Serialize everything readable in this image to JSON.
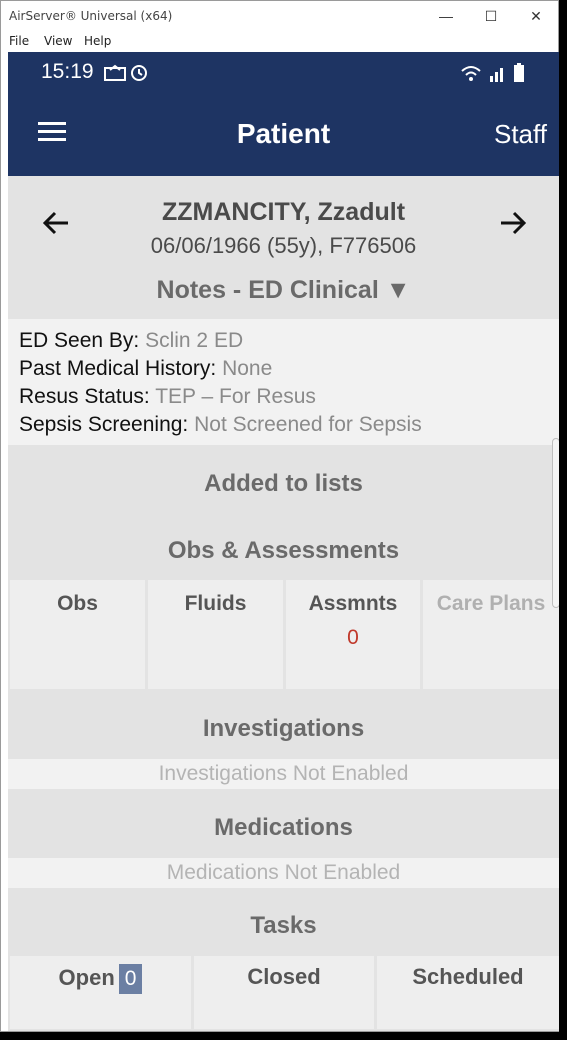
{
  "window": {
    "title": "AirServer® Universal (x64)",
    "minimize": "—",
    "maximize": "☐",
    "close": "✕"
  },
  "menu": [
    "File",
    "View",
    "Help"
  ],
  "status_bar": {
    "time": "15:19"
  },
  "app_bar": {
    "title": "Patient",
    "right_label": "Staff"
  },
  "patient": {
    "name": "ZZMANCITY, Zzadult",
    "details": "06/06/1966 (55y), F776506"
  },
  "notes_selector": {
    "label": "Notes - ED Clinical ▼"
  },
  "clinical_info": [
    {
      "key": "ED Seen By:",
      "value": "Sclin 2 ED"
    },
    {
      "key": "Past Medical History:",
      "value": "None"
    },
    {
      "key": "Resus Status:",
      "value": "TEP – For Resus"
    },
    {
      "key": "Sepsis Screening:",
      "value": "Not Screened for Sepsis"
    }
  ],
  "sections": {
    "added_to_lists": "Added to lists",
    "obs_assessments": "Obs & Assessments",
    "investigations": "Investigations",
    "investigations_notice": "Investigations Not Enabled",
    "medications": "Medications",
    "medications_notice": "Medications Not Enabled",
    "tasks": "Tasks"
  },
  "obs_tiles": [
    {
      "label": "Obs",
      "count": ""
    },
    {
      "label": "Fluids",
      "count": ""
    },
    {
      "label": "Assmnts",
      "count": "0"
    },
    {
      "label": "Care Plans",
      "count": ""
    }
  ],
  "task_tiles": [
    {
      "label": "Open",
      "badge": "0"
    },
    {
      "label": "Closed"
    },
    {
      "label": "Scheduled"
    }
  ],
  "colors": {
    "header": "#1e3463",
    "badge": "#6b7fa3",
    "alert": "#c0392b"
  }
}
